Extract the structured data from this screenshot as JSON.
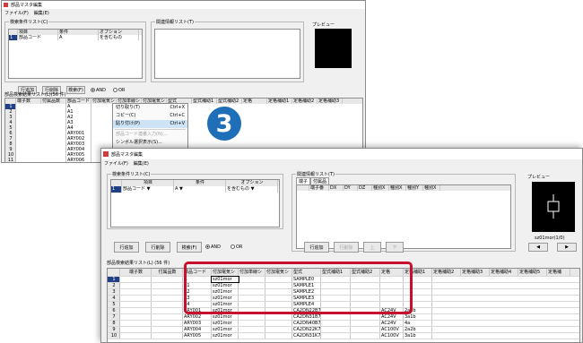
{
  "window_title": "部品マスタ編集",
  "menu": {
    "file": "ファイル(F)",
    "edit": "編集(E)"
  },
  "search_list": {
    "title": "検索条件リスト(C)",
    "col_item": "項目",
    "col_cond": "条件",
    "col_option": "オプション",
    "row_field": "部品コード",
    "row_value": "A",
    "row_option": "を含むもの"
  },
  "related_list": {
    "title": "関連情報リスト(T)",
    "tabs": [
      "端子",
      "付属品"
    ],
    "columns": [
      "端子番",
      "DX",
      "DY",
      "DZ",
      "種別X",
      "種別X",
      "種別Y",
      "種別X"
    ]
  },
  "preview": {
    "title": "プレビュー",
    "counter": "sz01mor(1/0)"
  },
  "buttons": {
    "add_row": "行追加",
    "delete_row": "行削除",
    "search": "検索(F)",
    "up": "上",
    "down": "下"
  },
  "radios": {
    "and": "AND",
    "or": "OR"
  },
  "parts_list": {
    "title": "部品検索結果リスト(L)",
    "count": "(56 件)",
    "columns": [
      "端子数",
      "付属品数",
      "部品コード",
      "付加電気シ",
      "付加単線シ",
      "付加電気シ",
      "型式",
      "型式補助1",
      "型式補助2",
      "定格",
      "定格補助1",
      "定格補助2",
      "定格補助3",
      "定格補助4",
      "定格補助5",
      "定格補"
    ],
    "rows": [
      {
        "n": "1",
        "code": "A",
        "attr": "sz01mor",
        "model": "SAMPLE0",
        "rating": "",
        "aux": ""
      },
      {
        "n": "2",
        "code": "A1",
        "attr": "sz01mor",
        "model": "SAMPLE1",
        "rating": "",
        "aux": ""
      },
      {
        "n": "3",
        "code": "A2",
        "attr": "sz01mor",
        "model": "SAMPLE2",
        "rating": "",
        "aux": ""
      },
      {
        "n": "4",
        "code": "A3",
        "attr": "sz01mor",
        "model": "SAMPLE3",
        "rating": "",
        "aux": ""
      },
      {
        "n": "5",
        "code": "A4",
        "attr": "sz01mor",
        "model": "SAMPLE4",
        "rating": "",
        "aux": ""
      },
      {
        "n": "6",
        "code": "ARY001",
        "attr": "sz01mor",
        "model": "CA2DN22B7",
        "rating": "AC24V",
        "aux": "2a2b"
      },
      {
        "n": "7",
        "code": "ARY002",
        "attr": "sz01mor",
        "model": "CA2DN31B7",
        "rating": "AC24V",
        "aux": "3a1b"
      },
      {
        "n": "8",
        "code": "ARY003",
        "attr": "sz01mor",
        "model": "CA2DN40B7",
        "rating": "AC24V",
        "aux": "4a"
      },
      {
        "n": "9",
        "code": "ARY004",
        "attr": "sz01mor",
        "model": "CA2DN22K7",
        "rating": "AC100V",
        "aux": "2a2b"
      },
      {
        "n": "10",
        "code": "ARY005",
        "attr": "sz01mor",
        "model": "CA2DN31K7",
        "rating": "AC100V",
        "aux": "3a1b"
      }
    ]
  },
  "back_rows": [
    {
      "n": "1",
      "code": "A"
    },
    {
      "n": "2",
      "code": "A1"
    },
    {
      "n": "3",
      "code": "A2"
    },
    {
      "n": "4",
      "code": "A3"
    },
    {
      "n": "5",
      "code": "A4"
    },
    {
      "n": "6",
      "code": "ARY001"
    },
    {
      "n": "7",
      "code": "ARY002"
    },
    {
      "n": "8",
      "code": "ARY003"
    },
    {
      "n": "9",
      "code": "ARY004"
    },
    {
      "n": "10",
      "code": "ARY005"
    },
    {
      "n": "11",
      "code": "ARY006"
    }
  ],
  "context_menu": [
    {
      "label": "切り取り(T)",
      "key": "Ctrl+X",
      "state": "normal"
    },
    {
      "label": "コピー(C)",
      "key": "Ctrl+C",
      "state": "normal"
    },
    {
      "label": "貼り付け(P)",
      "key": "Ctrl+V",
      "state": "selected"
    },
    {
      "label": "部品コード連番入力(N)...",
      "key": "",
      "state": "gray"
    },
    {
      "label": "シンボル選択表示(S)...",
      "key": "",
      "state": "normal"
    }
  ],
  "step_badge": "3"
}
